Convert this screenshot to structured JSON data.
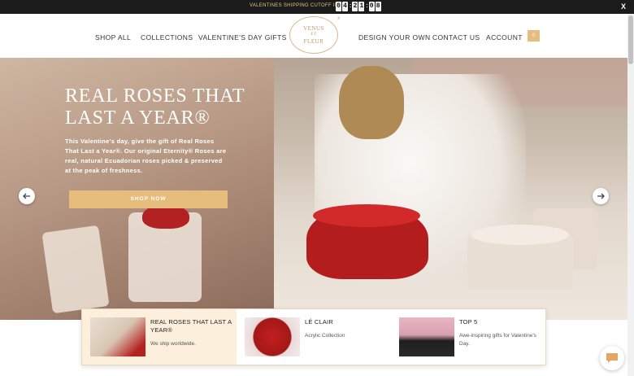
{
  "announcement": {
    "text": "VALENTINES SHIPPING CUTOFF IN:",
    "digits": [
      "0",
      "4",
      "2",
      "1",
      "0",
      "8"
    ],
    "close_label": "X"
  },
  "nav": {
    "shop_all": "SHOP ALL",
    "collections": "COLLECTIONS",
    "valentines": "VALENTINE'S DAY GIFTS",
    "design": "DESIGN YOUR OWN",
    "contact": "CONTACT US",
    "account": "ACCOUNT",
    "cart_count": "0"
  },
  "logo": {
    "line1": "VENUS",
    "line2": "ET",
    "line3": "FLEUR",
    "mark": "®"
  },
  "hero": {
    "headline": "REAL ROSES THAT LAST A YEAR®",
    "subtext": "This Valentine's day, give the gift of Real Roses That Last a Year®. Our original Eternity® Roses are real, natural Ecuadorian roses picked & preserved at the peak of freshness.",
    "cta": "SHOP NOW"
  },
  "cards": [
    {
      "title": "REAL ROSES THAT LAST A YEAR®",
      "subtitle": "We ship worldwide."
    },
    {
      "title": "LÉ CLAIR",
      "subtitle": "Acrylic Collection"
    },
    {
      "title": "TOP 5",
      "subtitle": "Awe-inspiring gifts for Valentine's Day."
    }
  ],
  "colors": {
    "accent": "#e6bd7c",
    "topbar": "#1b1b1b",
    "card_active": "#fcf0dd"
  }
}
